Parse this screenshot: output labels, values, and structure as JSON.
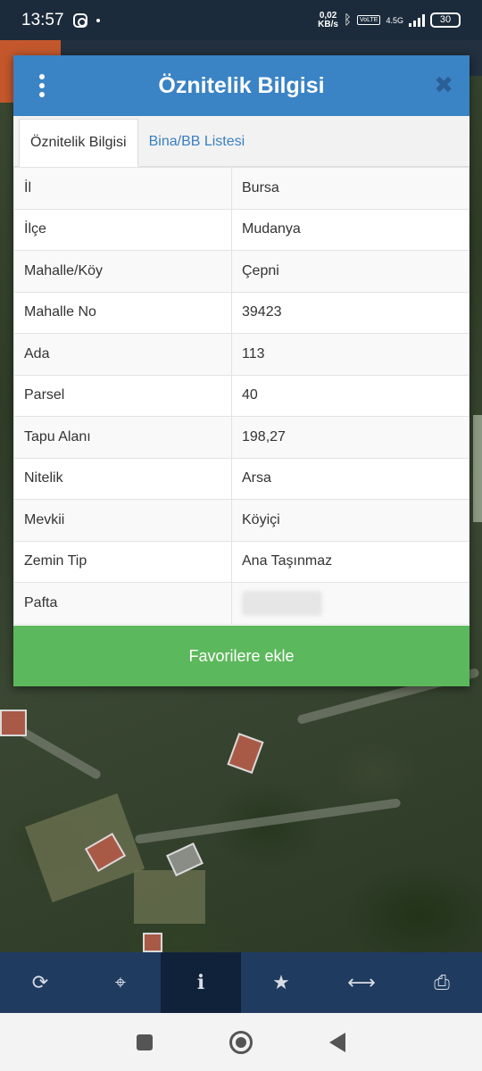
{
  "status_bar": {
    "time": "13:57",
    "net_speed_value": "0,02",
    "net_speed_unit": "KB/s",
    "network_type": "4.5G",
    "volte_label": "VoLTE",
    "battery": "30"
  },
  "dialog": {
    "title": "Öznitelik Bilgisi",
    "close_glyph": "✖",
    "tabs": [
      {
        "label": "Öznitelik Bilgisi",
        "active": true
      },
      {
        "label": "Bina/BB Listesi",
        "active": false
      }
    ],
    "rows": [
      {
        "key": "İl",
        "value": "Bursa"
      },
      {
        "key": "İlçe",
        "value": "Mudanya"
      },
      {
        "key": "Mahalle/Köy",
        "value": "Çepni"
      },
      {
        "key": "Mahalle No",
        "value": "39423"
      },
      {
        "key": "Ada",
        "value": "113"
      },
      {
        "key": "Parsel",
        "value": "40"
      },
      {
        "key": "Tapu Alanı",
        "value": "198,27"
      },
      {
        "key": "Nitelik",
        "value": "Arsa"
      },
      {
        "key": "Mevkii",
        "value": "Köyiçi"
      },
      {
        "key": "Zemin Tip",
        "value": "Ana Taşınmaz"
      },
      {
        "key": "Pafta",
        "value": ""
      }
    ],
    "favorite_button": "Favorilere ekle"
  },
  "toolbar": {
    "items": [
      {
        "icon": "refresh-icon",
        "glyph": "⟳"
      },
      {
        "icon": "crosshair-icon",
        "glyph": "⌖"
      },
      {
        "icon": "info-icon",
        "glyph": "i",
        "active": true
      },
      {
        "icon": "star-icon",
        "glyph": "★"
      },
      {
        "icon": "arrows-horizontal-icon",
        "glyph": "⟷"
      },
      {
        "icon": "print-icon",
        "glyph": "⎙"
      }
    ]
  },
  "colors": {
    "header": "#3a83c5",
    "favorite_button": "#5cb85c",
    "toolbar": "#1f3b60",
    "tab_link": "#3a7fc0"
  }
}
